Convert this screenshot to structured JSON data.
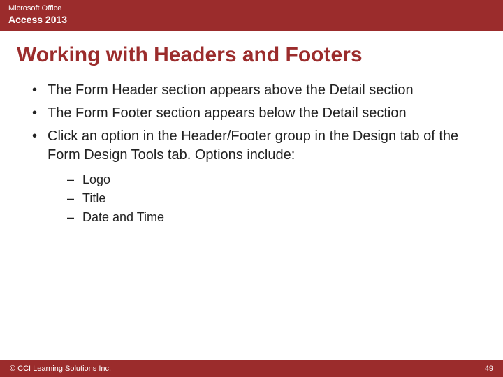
{
  "header": {
    "line1": "Microsoft Office",
    "line2": "Access 2013"
  },
  "title": "Working with Headers and Footers",
  "bullets": [
    "The Form Header section appears above the Detail section",
    "The Form Footer section appears below the Detail section",
    "Click an option in the Header/Footer group in the Design tab of the Form Design Tools tab. Options include:"
  ],
  "subitems": [
    "Logo",
    "Title",
    "Date and Time"
  ],
  "footer": {
    "copyright": "© CCI Learning Solutions Inc.",
    "page": "49"
  }
}
